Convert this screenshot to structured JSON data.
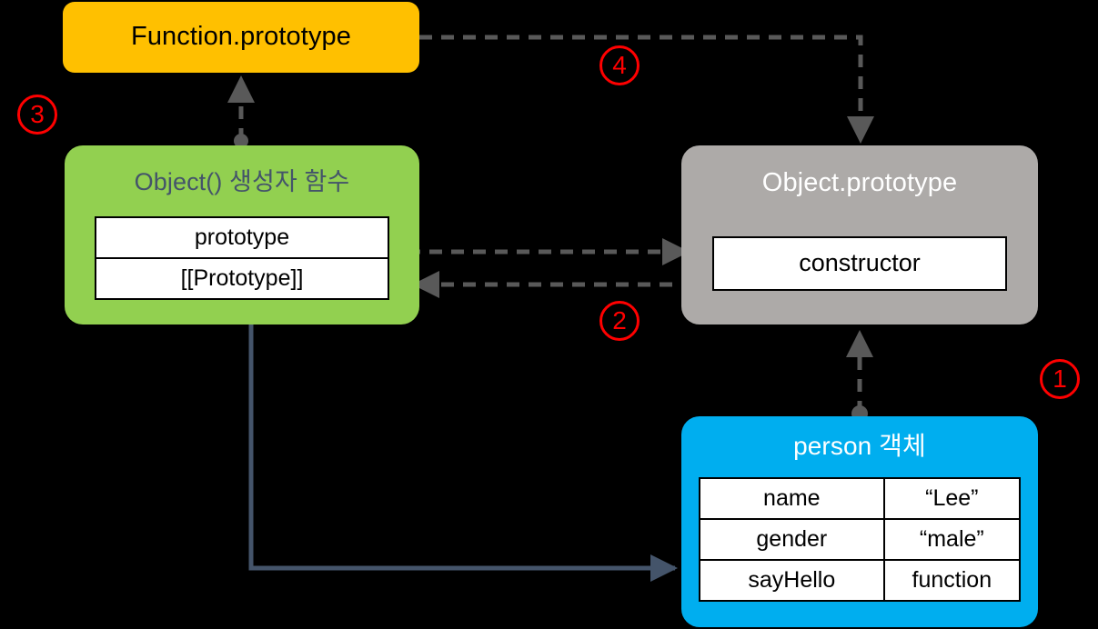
{
  "diagram": {
    "title": "JavaScript prototype chain diagram",
    "background": "#000000",
    "colors": {
      "function_prototype_box": "#FFC000",
      "object_constructor_box": "#92D050",
      "object_prototype_box": "#ADAAA8",
      "person_object_box": "#00AEEF",
      "dashed_connector": "#595959",
      "solid_connector": "#44546A",
      "step_marker": "#FF0000",
      "property_cell_bg": "#FFFFFF",
      "property_cell_border": "#000000"
    }
  },
  "nodes": {
    "function_prototype": {
      "title": "Function.prototype"
    },
    "object_constructor": {
      "title": "Object() 생성자 함수",
      "properties": [
        "prototype",
        "[[Prototype]]"
      ]
    },
    "object_prototype": {
      "title": "Object.prototype",
      "properties": [
        "constructor"
      ]
    },
    "person_object": {
      "title": "person 객체",
      "rows": [
        {
          "key": "name",
          "value": "“Lee”"
        },
        {
          "key": "gender",
          "value": "“male”"
        },
        {
          "key": "sayHello",
          "value": "function"
        }
      ]
    }
  },
  "steps": [
    {
      "id": "1",
      "label": "①"
    },
    {
      "id": "2",
      "label": "②"
    },
    {
      "id": "3",
      "label": "③"
    },
    {
      "id": "4",
      "label": "④"
    }
  ],
  "connectors": [
    {
      "name": "person-to-object-prototype",
      "style": "dashed",
      "from": "person 객체",
      "to": "Object.prototype",
      "step": "①"
    },
    {
      "name": "object-constructor-prototype-to-object-prototype",
      "style": "dashed",
      "from": "Object() 생성자 함수 . prototype",
      "to": "Object.prototype",
      "step": "②"
    },
    {
      "name": "object-prototype-constructor-to-object-constructor",
      "style": "dashed",
      "from": "Object.prototype . constructor",
      "to": "Object() 생성자 함수",
      "step": "②"
    },
    {
      "name": "object-constructor-to-function-prototype",
      "style": "dashed",
      "from": "Object() 생성자 함수 . [[Prototype]]",
      "to": "Function.prototype",
      "step": "③"
    },
    {
      "name": "function-prototype-to-object-prototype",
      "style": "dashed",
      "from": "Function.prototype",
      "to": "Object.prototype",
      "step": "④"
    },
    {
      "name": "object-constructor-to-person",
      "style": "solid",
      "from": "Object() 생성자 함수",
      "to": "person 객체"
    }
  ]
}
